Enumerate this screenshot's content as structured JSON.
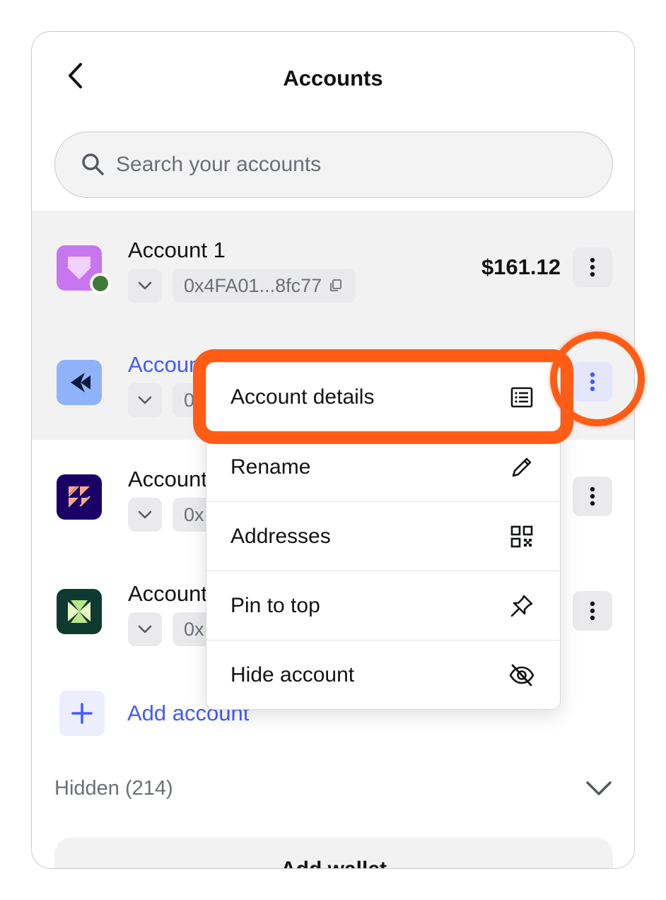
{
  "header": {
    "title": "Accounts"
  },
  "search": {
    "placeholder": "Search your accounts"
  },
  "accounts": [
    {
      "name": "Account 1",
      "address": "0x4FA01...8fc77",
      "balance": "$161.12",
      "avatar_color": "#c876ef"
    },
    {
      "name": "Account 2",
      "address": "0x",
      "avatar_color": "#8fb2fb"
    },
    {
      "name": "Account 3",
      "address": "0x",
      "avatar_color": "#190066"
    },
    {
      "name": "Account 4",
      "address": "0x",
      "avatar_color": "#0f3a2f"
    }
  ],
  "add_account": {
    "label": "Add account"
  },
  "hidden": {
    "label": "Hidden (214)"
  },
  "add_wallet": {
    "label": "Add wallet"
  },
  "menu": {
    "items": [
      {
        "label": "Account details",
        "icon": "details-icon"
      },
      {
        "label": "Rename",
        "icon": "pencil-icon"
      },
      {
        "label": "Addresses",
        "icon": "qr-code-icon"
      },
      {
        "label": "Pin to top",
        "icon": "pin-icon"
      },
      {
        "label": "Hide account",
        "icon": "eye-slash-icon"
      }
    ]
  },
  "colors": {
    "accent": "#4459ff",
    "highlight": "#ff5c16",
    "status_green": "#3f7a3a"
  }
}
